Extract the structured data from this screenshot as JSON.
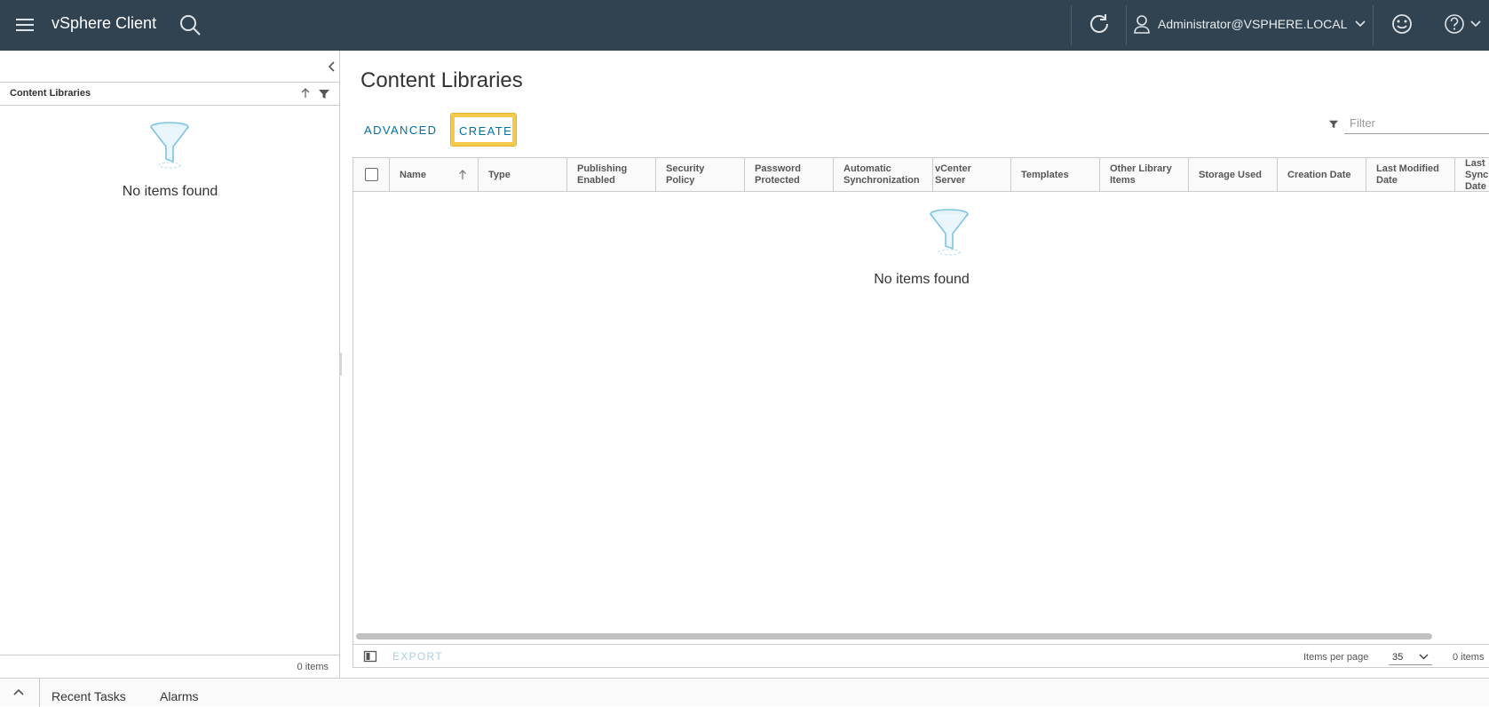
{
  "header": {
    "app_title": "vSphere Client",
    "user": "Administrator@VSPHERE.LOCAL",
    "bg_color": "#314351"
  },
  "left_panel": {
    "tree_title": "Content Libraries",
    "empty_text": "No items found",
    "footer_count": "0 items"
  },
  "main": {
    "page_title": "Content Libraries",
    "actions": {
      "advanced": "ADVANCED",
      "create": "CREATE"
    },
    "filter_placeholder": "Filter",
    "columns": [
      "Name",
      "Type",
      "Publishing Enabled",
      "Security Policy",
      "Password Protected",
      "Automatic Synchronization",
      "vCenter Server",
      "Templates",
      "Other Library Items",
      "Storage Used",
      "Creation Date",
      "Last Modified Date",
      "Last Sync Date"
    ],
    "empty_text": "No items found",
    "footer": {
      "export": "EXPORT",
      "items_per_page_label": "Items per page",
      "items_per_page_value": "35",
      "count": "0 items"
    }
  },
  "bottom": {
    "tabs": [
      "Recent Tasks",
      "Alarms"
    ]
  },
  "colors": {
    "accent": "#0072a3",
    "highlight": "#f6c94a"
  }
}
